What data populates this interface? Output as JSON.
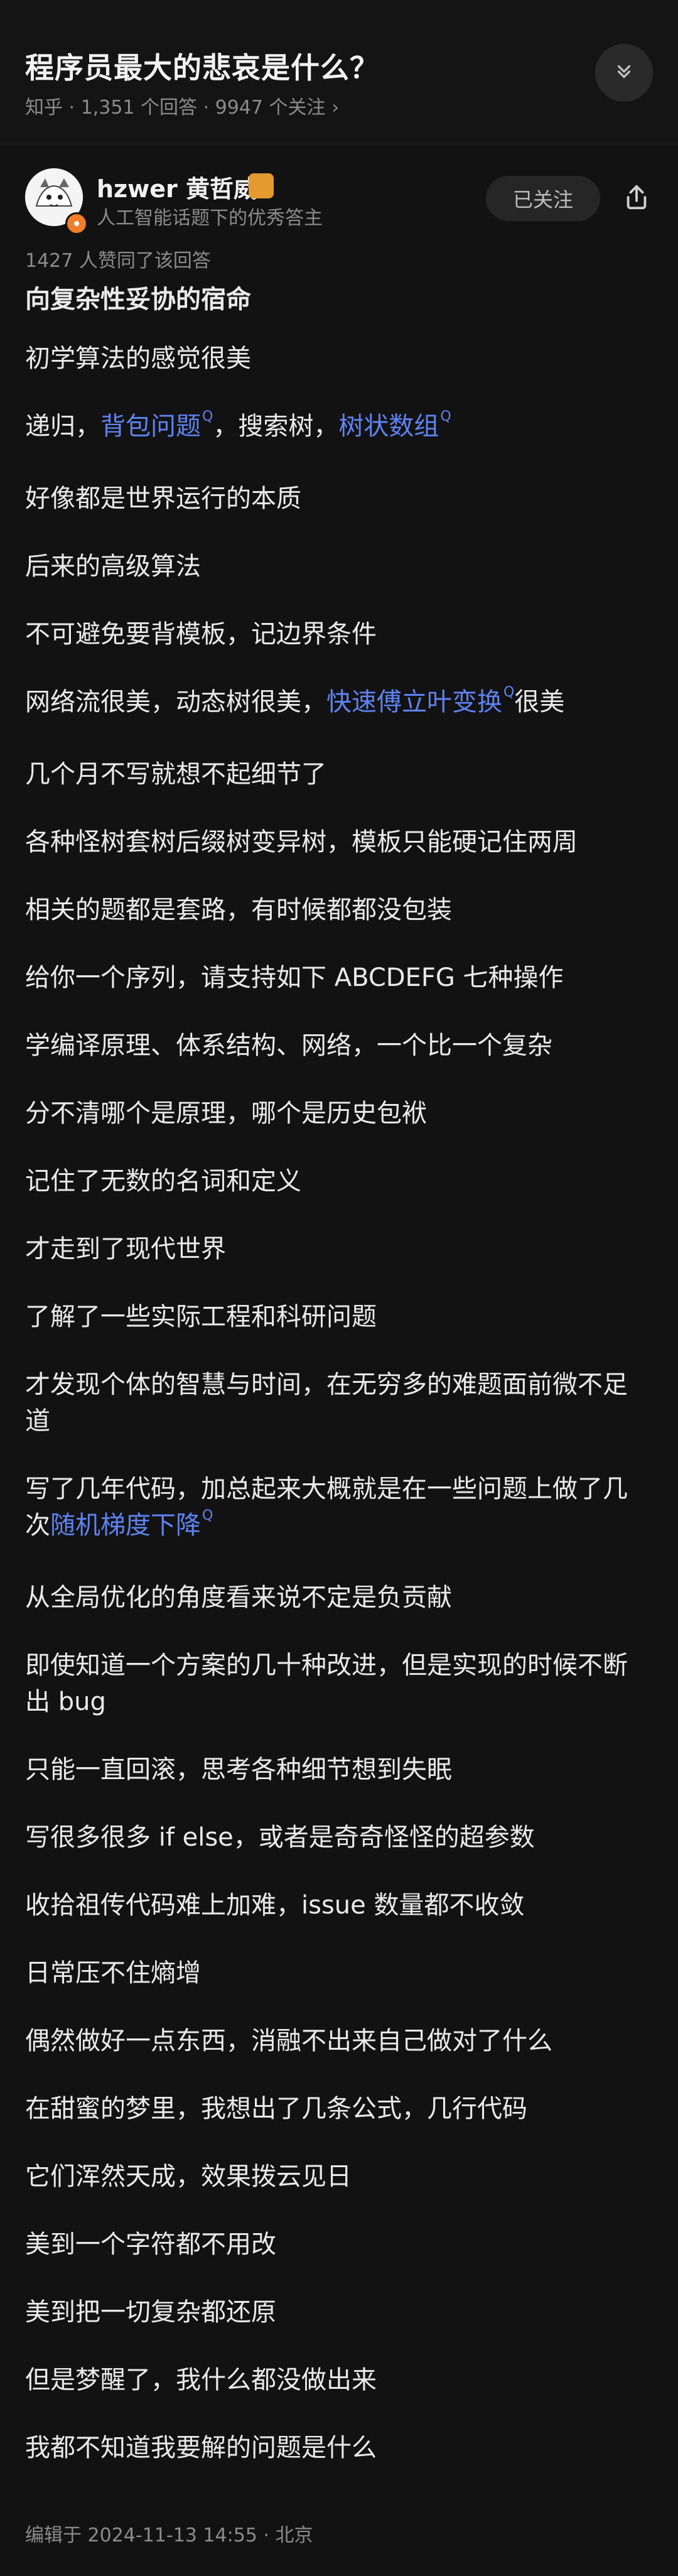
{
  "question": {
    "title": "程序员最大的悲哀是什么？",
    "source": "知乎",
    "answers": "1,351 个回答",
    "followers": "9947 个关注",
    "meta_arrow": "›"
  },
  "author": {
    "name": "hzwer 黄哲威",
    "desc": "人工智能话题下的优秀答主",
    "follow_label": "已关注"
  },
  "answer": {
    "votes": "1427 人赞同了该回答",
    "title": "向复杂性妥协的宿命",
    "lines": [
      "初学算法的感觉很美",
      {
        "p": "递归，"
      },
      {
        "p": "背包问题"
      },
      {
        "p": "，搜索树，"
      },
      {
        "p": "树状数组"
      },
      "好像都是世界运行的本质",
      "后来的高级算法",
      "不可避免要背模板，记边界条件",
      {
        "p": "网络流很美，动态树很美，"
      },
      {
        "p": "快速傅立叶变换"
      },
      {
        "p": "很美"
      },
      "几个月不写就想不起细节了",
      "各种怪树套树后缀树变异树，模板只能硬记住两周",
      "相关的题都是套路，有时候都都没包装",
      "给你一个序列，请支持如下 ABCDEFG 七种操作",
      "学编译原理、体系结构、网络，一个比一个复杂",
      "分不清哪个是原理，哪个是历史包袱",
      "记住了无数的名词和定义",
      "才走到了现代世界",
      "了解了一些实际工程和科研问题",
      "才发现个体的智慧与时间，在无穷多的难题面前微不足道",
      {
        "p": "写了几年代码，加总起来大概就是在一些问题上做了几次"
      },
      {
        "p": "随机梯度下降"
      },
      "从全局优化的角度看来说不定是负贡献",
      "即使知道一个方案的几十种改进，但是实现的时候不断出 bug",
      "只能一直回滚，思考各种细节想到失眠",
      "写很多很多 if else，或者是奇奇怪怪的超参数",
      "收拾祖传代码难上加难，issue 数量都不收敛",
      "日常压不住熵增",
      "偶然做好一点东西，消融不出来自己做对了什么",
      "在甜蜜的梦里，我想出了几条公式，几行代码",
      "它们浑然天成，效果拨云见日",
      "美到一个字符都不用改",
      "美到把一切复杂都还原",
      "但是梦醒了，我什么都没做出来",
      "我都不知道我要解的问题是什么"
    ],
    "edited": "编辑于 2024-11-13 14:55 · 北京",
    "link_mark": "Q"
  },
  "colors": {
    "background": "#121212",
    "link": "#5E83F2",
    "muted": "#8B8B8B"
  },
  "icons": {
    "collapse": "chevrons-down-icon",
    "share": "share-icon"
  }
}
